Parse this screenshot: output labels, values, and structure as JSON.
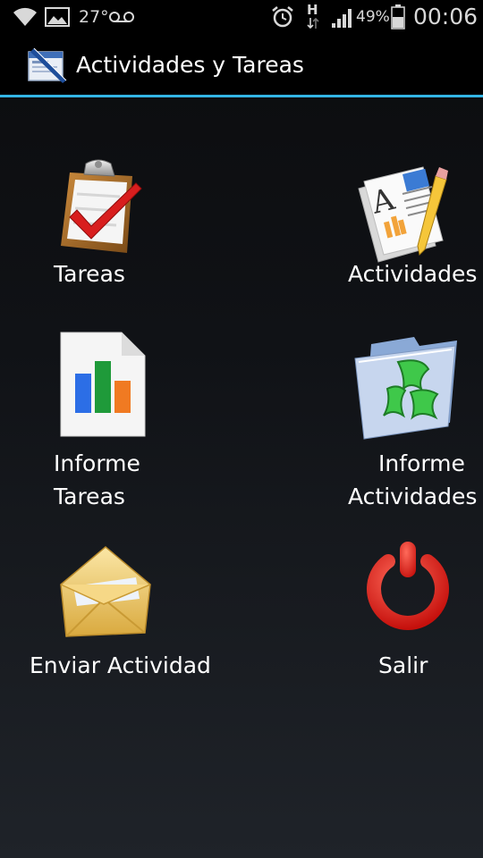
{
  "status_bar": {
    "temperature": "27°",
    "battery_percent": "49%",
    "network_type": "H",
    "time": "00:06",
    "icons": [
      "wifi-icon",
      "image-icon",
      "voicemail-icon",
      "alarm-icon",
      "data-transfer-icon",
      "signal-icon",
      "battery-icon"
    ]
  },
  "action_bar": {
    "title": "Actividades y Tareas",
    "icon": "app-logo-icon",
    "accent_color": "#33b5e5"
  },
  "menu": {
    "items": [
      {
        "id": "tareas",
        "line1": "Tareas",
        "line2": "",
        "icon": "clipboard-check-icon"
      },
      {
        "id": "actividades",
        "line1": "Actividades",
        "line2": "",
        "icon": "document-pencil-icon"
      },
      {
        "id": "informe-tareas",
        "line1": "Informe",
        "line2": "Tareas",
        "icon": "bar-chart-document-icon"
      },
      {
        "id": "informe-actividades",
        "line1": "Informe",
        "line2": "Actividades",
        "icon": "folder-excel-icon"
      },
      {
        "id": "enviar-actividad",
        "line1": "Enviar Actividad",
        "line2": "",
        "icon": "envelope-icon"
      },
      {
        "id": "salir",
        "line1": "Salir",
        "line2": "",
        "icon": "power-icon"
      }
    ]
  }
}
